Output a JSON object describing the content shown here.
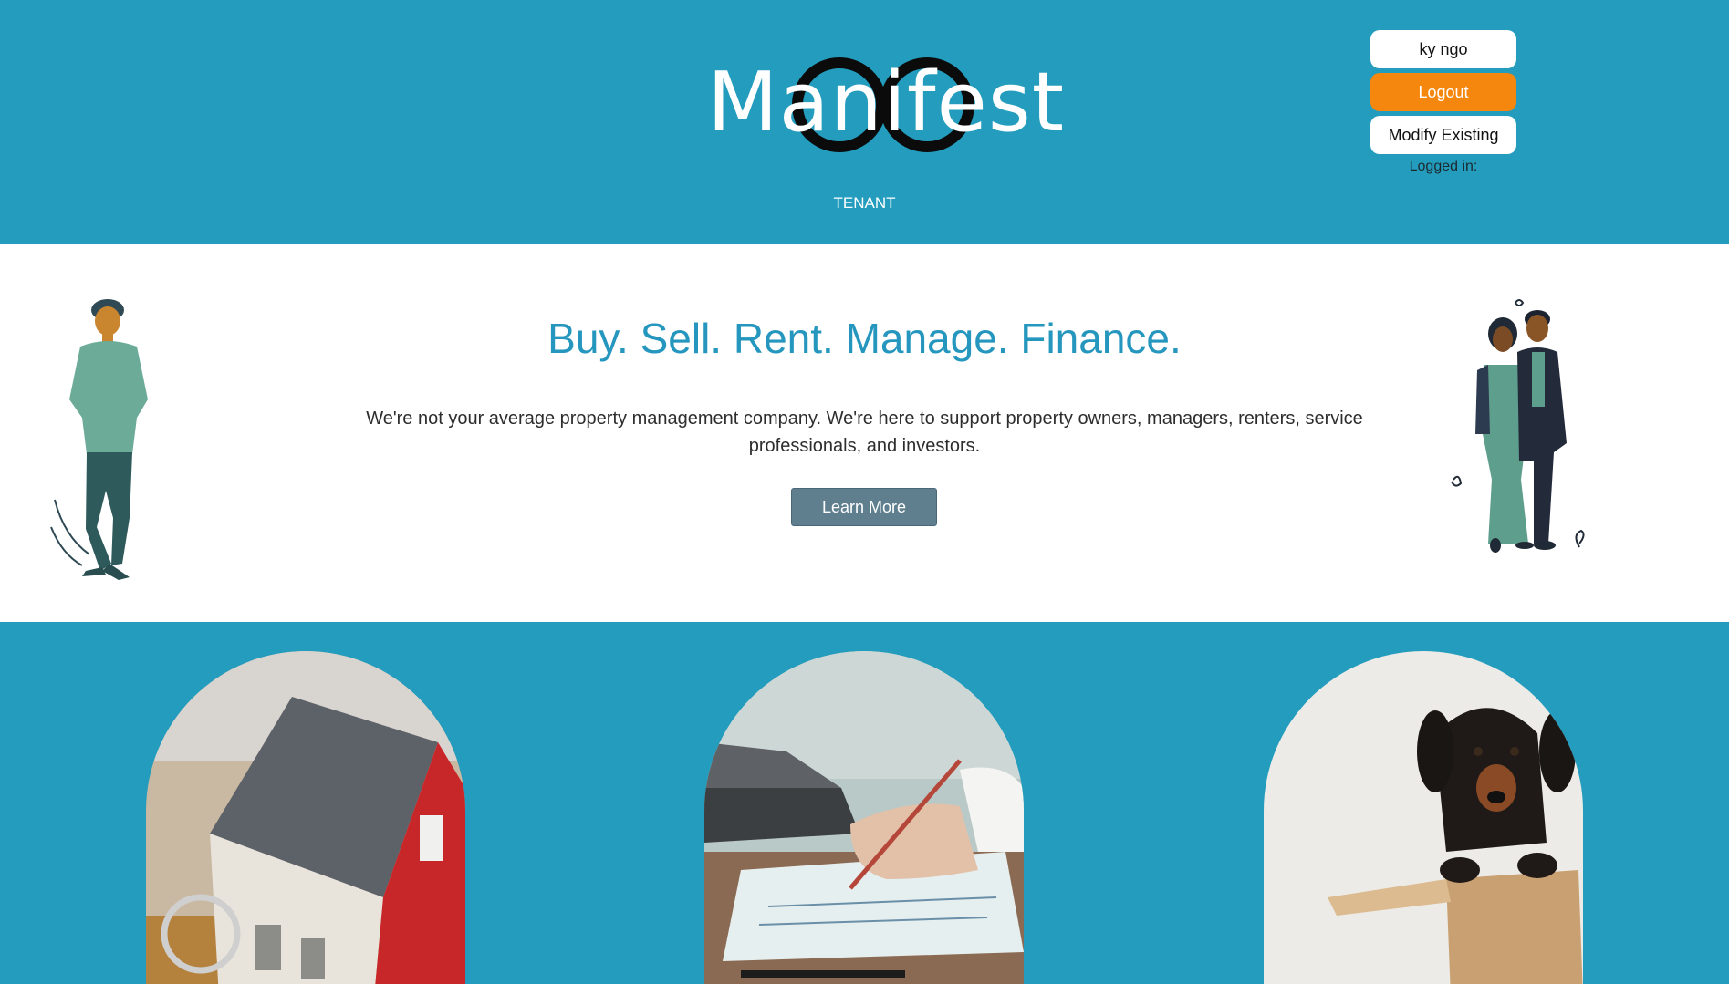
{
  "header": {
    "logo_text": "Manifest",
    "role": "TENANT",
    "user_name": "ky ngo",
    "logout_label": "Logout",
    "modify_label": "Modify Existing",
    "logged_in_label": "Logged in:"
  },
  "hero": {
    "title": "Buy. Sell. Rent. Manage. Finance.",
    "description": "We're not your average property management company. We're here to support property owners, managers, renters, service professionals, and investors.",
    "cta_label": "Learn More"
  },
  "colors": {
    "brand_teal": "#239cbd",
    "title_teal": "#2596bd",
    "logout_orange": "#f5870f",
    "cta_slate": "#5f7f8f"
  },
  "cards": [
    {
      "image": "house-model-with-keys"
    },
    {
      "image": "hand-writing-near-laptop"
    },
    {
      "image": "dachshund-in-box"
    }
  ]
}
